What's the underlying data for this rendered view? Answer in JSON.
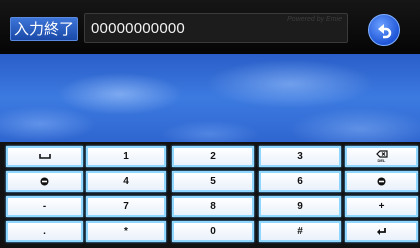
{
  "header": {
    "done_label": "入力終了",
    "number_value": "00000000000",
    "powered_text": "Powered by Emie"
  },
  "keypad": {
    "rows": [
      [
        "space-icon",
        "1",
        "2",
        "3",
        "backspace-icon"
      ],
      [
        "minus-circle-icon",
        "4",
        "5",
        "6",
        "minus-circle-icon"
      ],
      [
        "-",
        "7",
        "8",
        "9",
        "+"
      ],
      [
        ".",
        "*",
        "0",
        "#",
        "enter-icon"
      ]
    ],
    "backspace_caption": "DEL"
  },
  "colors": {
    "key_border": "#8fd7ff",
    "done_button": "#2a5ec8",
    "sky": "#3c7ae0"
  }
}
